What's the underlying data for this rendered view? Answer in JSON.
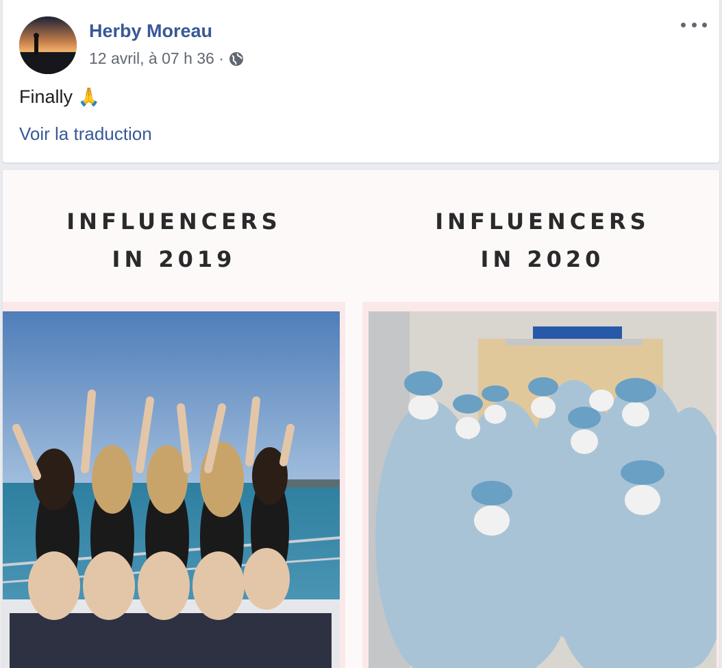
{
  "post": {
    "author": "Herby Moreau",
    "timestamp": "12 avril, à 07 h 36 ·",
    "privacy_icon": "globe-icon",
    "text": "Finally",
    "emoji": "🙏",
    "translate_label": "Voir la traduction",
    "more_icon": "more-options-icon"
  },
  "meme": {
    "left_title_line1": "INFLUENCERS",
    "left_title_line2": "IN 2019",
    "right_title_line1": "INFLUENCERS",
    "right_title_line2": "IN 2020"
  },
  "colors": {
    "link": "#385898",
    "meta": "#616770",
    "background": "#e9ebee"
  }
}
